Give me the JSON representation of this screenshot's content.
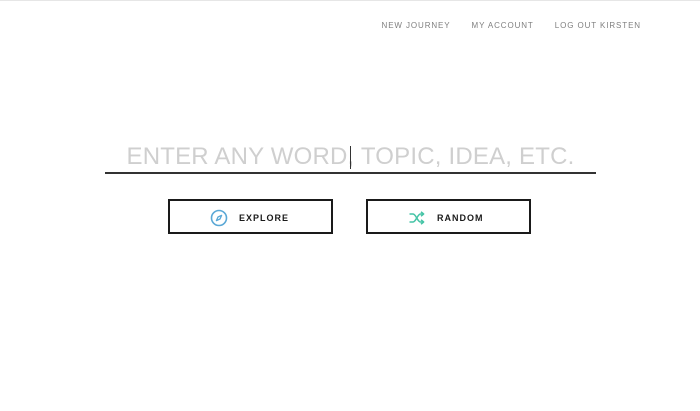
{
  "nav": {
    "items": [
      {
        "label": "NEW JOURNEY"
      },
      {
        "label": "MY ACCOUNT"
      },
      {
        "label": "LOG OUT KIRSTEN"
      }
    ]
  },
  "search": {
    "placeholder": "ENTER ANY WORD, TOPIC, IDEA, ETC."
  },
  "buttons": {
    "explore": {
      "label": "EXPLORE",
      "icon": "compass-icon",
      "icon_color": "#5aa8d6"
    },
    "random": {
      "label": "RANDOM",
      "icon": "shuffle-icon",
      "icon_color": "#45c4a6"
    }
  }
}
